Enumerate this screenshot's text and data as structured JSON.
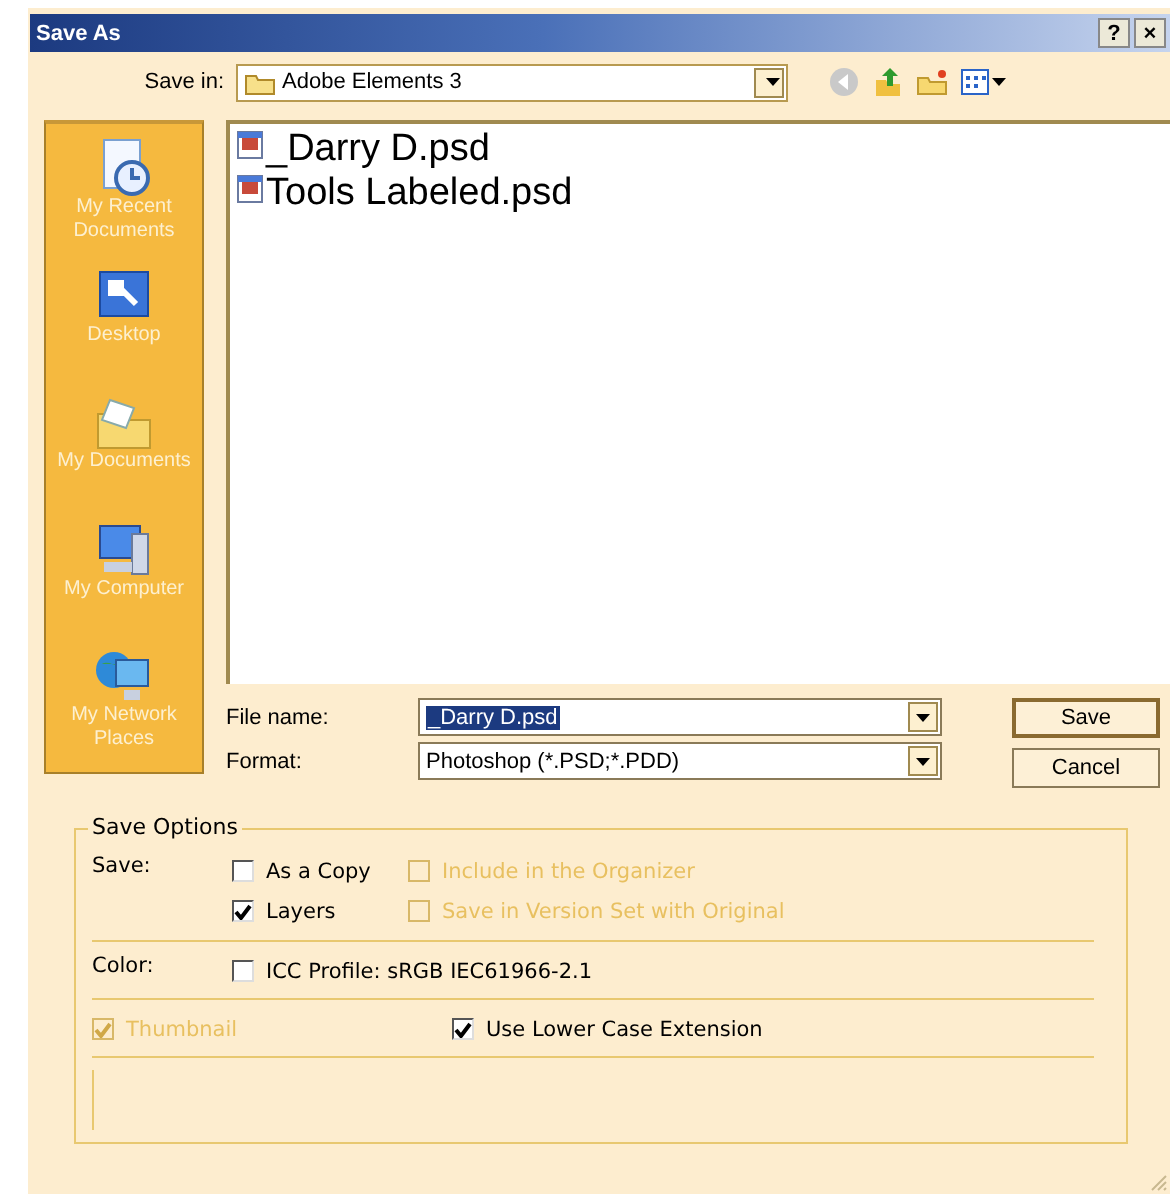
{
  "window": {
    "title": "Save As",
    "help_button": "?",
    "close_button": "×"
  },
  "save_in": {
    "label": "Save in:",
    "value": "Adobe Elements 3"
  },
  "places": [
    {
      "label": "My Recent Documents",
      "kind": "recent"
    },
    {
      "label": "Desktop",
      "kind": "desktop"
    },
    {
      "label": "My Documents",
      "kind": "documents"
    },
    {
      "label": "My Computer",
      "kind": "computer"
    },
    {
      "label": "My Network Places",
      "kind": "network"
    }
  ],
  "files": [
    {
      "name": "_Darry D.psd",
      "selected": false
    },
    {
      "name": "Tools Labeled.psd",
      "selected": false
    }
  ],
  "file_name": {
    "label": "File name:",
    "value": "_Darry D.psd"
  },
  "format": {
    "label": "Format:",
    "value": "Photoshop (*.PSD;*.PDD)"
  },
  "buttons": [
    "Save",
    "Cancel"
  ],
  "save_options": {
    "title": "Save Options",
    "save_label": "Save:",
    "save_checks": [
      {
        "label": "As a Copy",
        "checked": false,
        "disabled": false
      },
      {
        "label": "Include in the Organizer",
        "checked": false,
        "disabled": true
      },
      {
        "label": "Layers",
        "checked": true,
        "disabled": false
      },
      {
        "label": "Save in Version Set with Original",
        "checked": false,
        "disabled": true
      }
    ],
    "color_label": "Color:",
    "color_check": {
      "label": "ICC Profile:  sRGB IEC61966-2.1",
      "checked": false,
      "disabled": false
    },
    "bottom_checks": [
      {
        "label": "Thumbnail",
        "checked": true,
        "disabled": true
      },
      {
        "label": "Use Lower Case Extension",
        "checked": true,
        "disabled": false
      }
    ]
  }
}
